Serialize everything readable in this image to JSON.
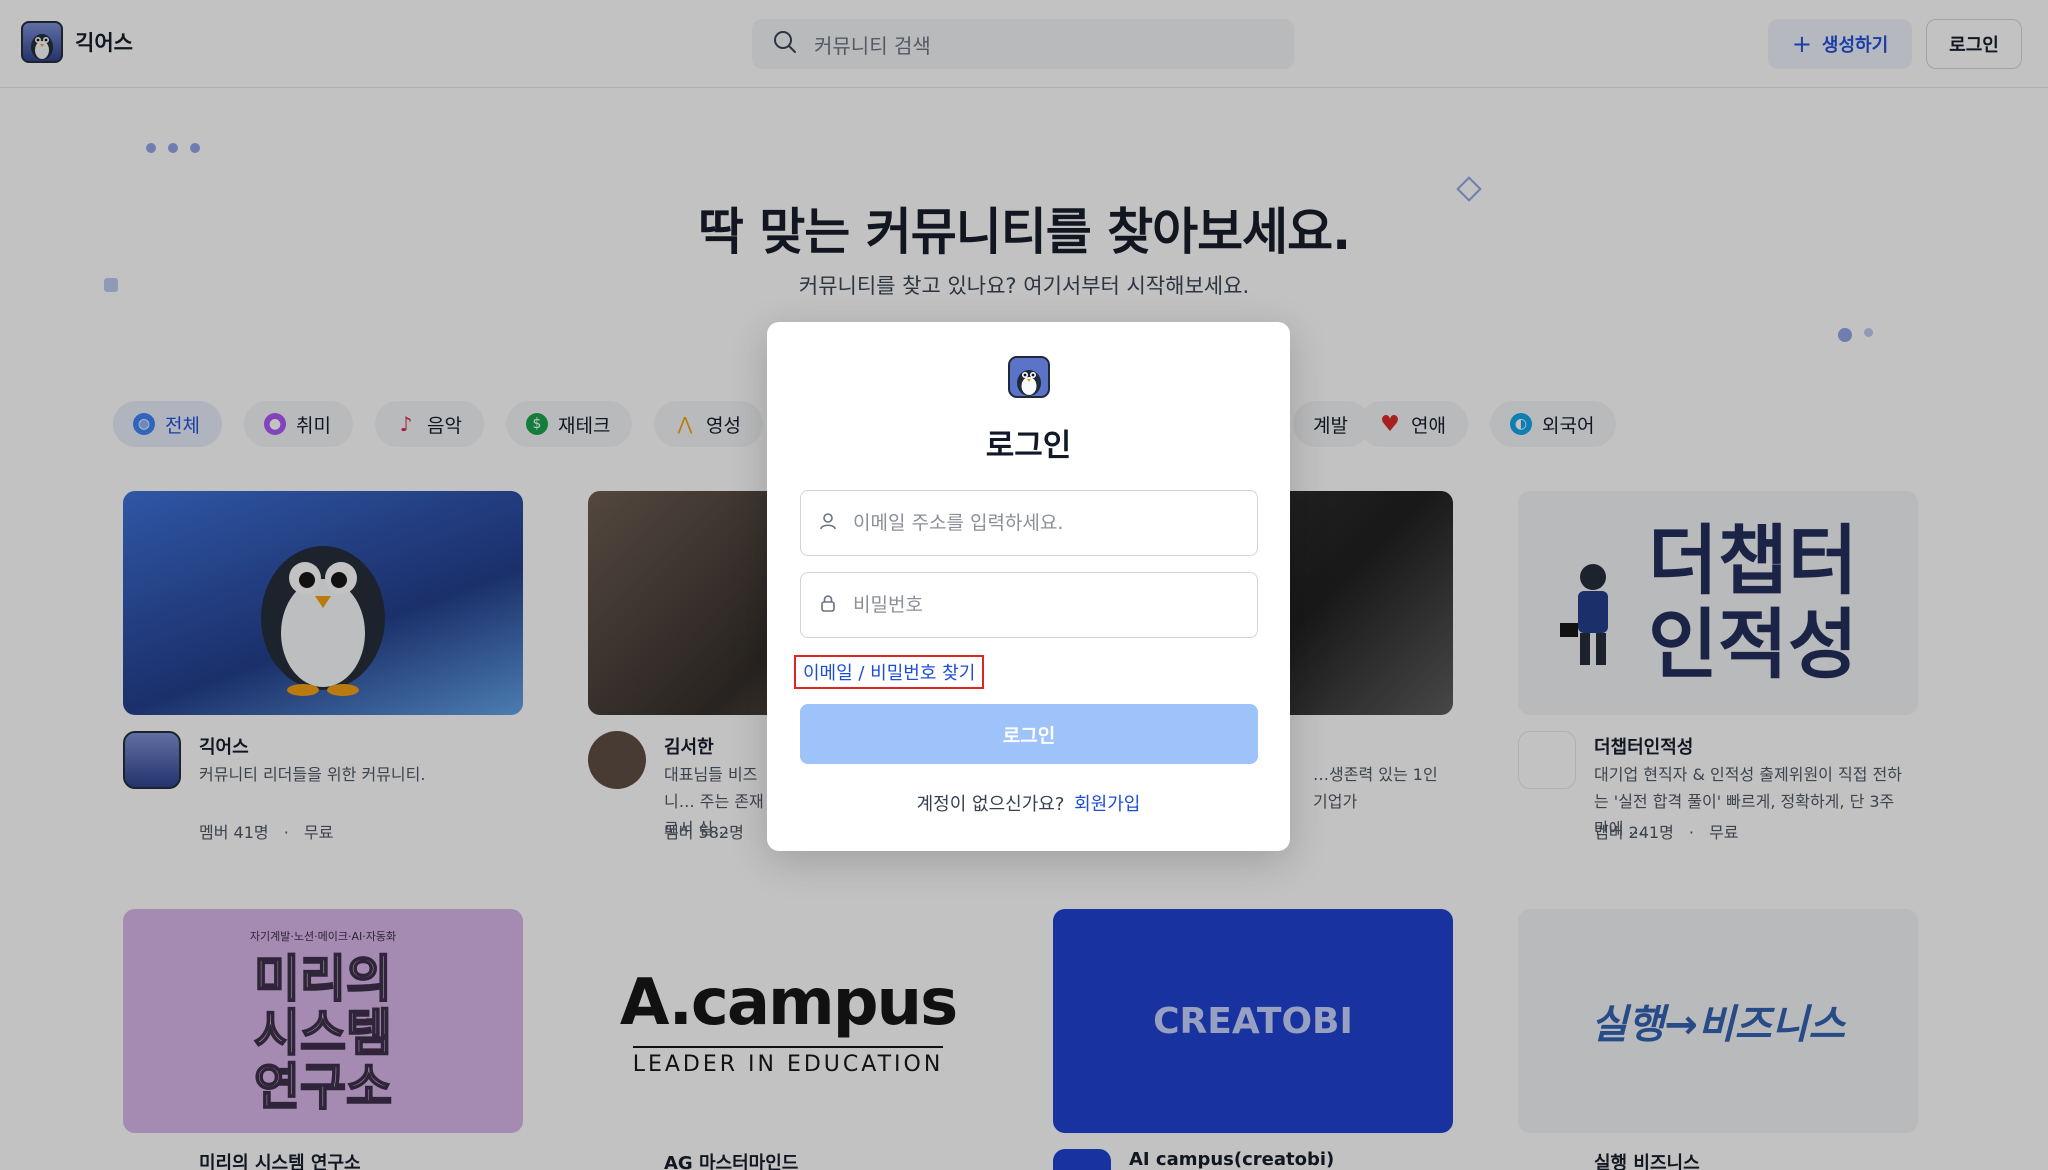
{
  "header": {
    "brand": "긱어스",
    "search_placeholder": "커뮤니티 검색",
    "create_label": "생성하기",
    "login_label": "로그인"
  },
  "hero": {
    "title": "딱 맞는 커뮤니티를 찾아보세요.",
    "subtitle": "커뮤니티를 찾고 있나요? 여기서부터 시작해보세요."
  },
  "categories": [
    {
      "label": "전체",
      "icon": "globe-icon",
      "color": "#3b82f6"
    },
    {
      "label": "취미",
      "icon": "palette-icon",
      "color": "#a855f7"
    },
    {
      "label": "음악",
      "icon": "music-note-icon",
      "color": "#e11d48"
    },
    {
      "label": "재테크",
      "icon": "dollar-icon",
      "color": "#16a34a"
    },
    {
      "label": "영성",
      "icon": "praying-hands-icon",
      "color": "#f59e0b"
    },
    {
      "label": "계발",
      "icon": "growth-icon",
      "color": "#6b7280"
    },
    {
      "label": "연애",
      "icon": "heart-icon",
      "color": "#dc2626"
    },
    {
      "label": "외국어",
      "icon": "earth-icon",
      "color": "#0ea5e9"
    }
  ],
  "cards_row1": [
    {
      "name": "긱어스",
      "desc": "커뮤니티 리더들을 위한 커뮤니티.",
      "members": "멤버 41명",
      "price": "무료"
    },
    {
      "name": "김서한",
      "desc": "대표님들 비즈니… 주는 존재로서 실…",
      "members": "멤버 582명",
      "price": ""
    },
    {
      "name": "",
      "desc": "…생존력 있는 1인 기업가",
      "members": "",
      "price": ""
    },
    {
      "name": "더챕터인적성",
      "desc": "대기업 현직자 & 인적성 출제위원이 직접 전하는 '실전 합격 풀이' 빠르게, 정확하게, 단 3주 만에 ...",
      "members": "멤버 241명",
      "price": "무료",
      "cover_text": "더챕터 인적성"
    }
  ],
  "cards_row2": [
    {
      "name": "미리의 시스템 연구소",
      "cover_top": "자기계발·노션·메이크·AI·자동화",
      "cover_text": "미리의 시스템 연구소"
    },
    {
      "name": "AG 마스터마인드",
      "cover_text": "A.campus",
      "cover_sub": "LEADER IN EDUCATION"
    },
    {
      "name": "AI campus(creatobi)",
      "cover_text": "CREATOBI"
    },
    {
      "name": "실행 비즈니스",
      "cover_text": "실행→비즈니스"
    }
  ],
  "modal": {
    "title": "로그인",
    "email_placeholder": "이메일 주소를 입력하세요.",
    "password_placeholder": "비밀번호",
    "find_link": "이메일 / 비밀번호 찾기",
    "submit_label": "로그인",
    "signup_prompt": "계정이 없으신가요?",
    "signup_link": "회원가입"
  },
  "colors": {
    "accent": "#1d4ed8",
    "submit_disabled": "#9ec3fb",
    "highlight_border": "#dc2626"
  }
}
